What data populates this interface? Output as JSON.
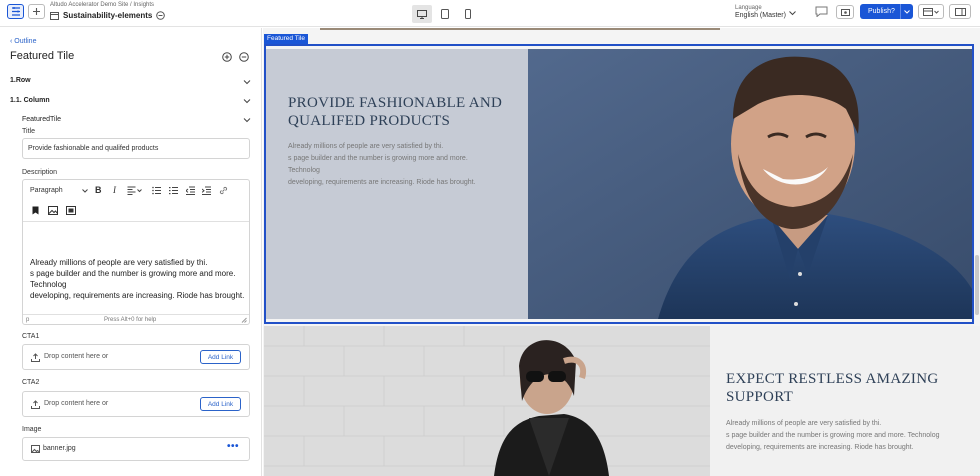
{
  "topbar": {
    "breadcrumb": "Altudo Accelerator Demo Site  /  Insights",
    "page_name": "Sustainability-elements",
    "language_label": "Language",
    "language_value": "English (Master)",
    "publish_label": "Publish?"
  },
  "sidebar": {
    "outline_link": "Outline",
    "component_title": "Featured Tile",
    "tree": [
      "1.Row",
      "1.1. Column",
      "FeaturedTile"
    ],
    "title_label": "Title",
    "title_value": "Provide fashionable and qualifed products",
    "description_label": "Description",
    "paragraph_select": "Paragraph",
    "description_lines": [
      "Already millions of people are very satisfied by thi.",
      "s page builder and the number is growing more and more.",
      "Technolog",
      "developing, requirements are increasing. Riode has brought."
    ],
    "rte_path": "p",
    "rte_help": "Press Alt+0 for help",
    "cta1_label": "CTA1",
    "cta1_placeholder": "Drop content here or",
    "cta2_label": "CTA2",
    "cta2_placeholder": "Drop content here or",
    "add_link": "Add Link",
    "image_label": "Image",
    "image_value": "banner.jpg"
  },
  "canvas": {
    "tile_tag": "Featured Tile",
    "tile1_heading": [
      "PROVIDE FASHIONABLE AND",
      "QUALIFED PRODUCTS"
    ],
    "tile1_body": [
      "Already millions of people are very satisfied by thi.",
      "s page builder and the number is growing more and more.",
      "Technolog",
      "developing, requirements are increasing. Riode has brought."
    ],
    "tile2_heading": [
      "EXPECT RESTLESS AMAZING",
      "SUPPORT"
    ],
    "tile2_body": [
      "Already millions of people are very satisfied by thi.",
      "s page builder and the number is growing more and more. Technolog",
      "developing, requirements are increasing. Riode has brought."
    ]
  },
  "colors": {
    "accent": "#1a56d6",
    "tile_left_bg": "#c6cbd5",
    "heading": "#2e4057"
  }
}
